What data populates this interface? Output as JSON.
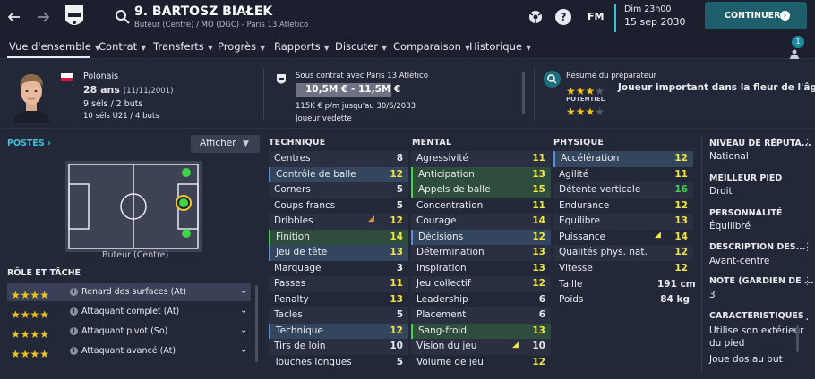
{
  "header": {
    "player_title": "9. BARTOSZ BIAŁEK",
    "player_subtitle": "Buteur (Centre) / MO (DGC) - Paris 13 Atlético",
    "fm_label": "FM",
    "date_time": "Dim 23h00",
    "date": "15 sep 2030",
    "continue_label": "CONTINUER",
    "notification_count": "1"
  },
  "nav": {
    "items": [
      "Vue d'ensemble",
      "Contrat",
      "Transferts",
      "Progrès",
      "Rapports",
      "Discuter",
      "Comparaison",
      "Historique"
    ]
  },
  "info": {
    "nationality": "Polonais",
    "age": "28 ans",
    "birthdate": "(11/11/2001)",
    "caps": "9 séls / 2 buts",
    "u21": "10 séls U21 / 4 buts",
    "contract_title": "Sous contrat avec Paris 13 Atlético",
    "value": "10,5M € - 11,5M €",
    "wage": "115K € p/m jusqu'au 30/6/2033",
    "status": "Joueur vedette",
    "coach_title": "Résumé du préparateur",
    "coach_summary": "Joueur important dans la fleur de l'âge",
    "potential_label": "POTENTIEL",
    "current_stars": 3,
    "potential_stars": 3
  },
  "positions": {
    "title": "POSTES",
    "show_button": "Afficher",
    "position_label": "Buteur (Centre)"
  },
  "roles": {
    "title": "RÔLE ET TÂCHE",
    "items": [
      {
        "name": "Renard des surfaces (At)",
        "stars": 4
      },
      {
        "name": "Attaquant complet (At)",
        "stars": 4
      },
      {
        "name": "Attaquant pivot (So)",
        "stars": 4
      },
      {
        "name": "Attaquant avancé (At)",
        "stars": 4
      }
    ]
  },
  "attributes": {
    "technique_title": "TECHNIQUE",
    "mental_title": "MENTAL",
    "physique_title": "PHYSIQUE",
    "technique": [
      {
        "name": "Centres",
        "value": "8"
      },
      {
        "name": "Contrôle de balle",
        "value": "12"
      },
      {
        "name": "Corners",
        "value": "5"
      },
      {
        "name": "Coups francs",
        "value": "5"
      },
      {
        "name": "Dribbles",
        "value": "12"
      },
      {
        "name": "Finition",
        "value": "14"
      },
      {
        "name": "Jeu de tête",
        "value": "13"
      },
      {
        "name": "Marquage",
        "value": "3"
      },
      {
        "name": "Passes",
        "value": "11"
      },
      {
        "name": "Penalty",
        "value": "13"
      },
      {
        "name": "Tacles",
        "value": "5"
      },
      {
        "name": "Technique",
        "value": "12"
      },
      {
        "name": "Tirs de loin",
        "value": "10"
      },
      {
        "name": "Touches longues",
        "value": "5"
      }
    ],
    "mental": [
      {
        "name": "Agressivité",
        "value": "11"
      },
      {
        "name": "Anticipation",
        "value": "13"
      },
      {
        "name": "Appels de balle",
        "value": "15"
      },
      {
        "name": "Concentration",
        "value": "11"
      },
      {
        "name": "Courage",
        "value": "14"
      },
      {
        "name": "Décisions",
        "value": "12"
      },
      {
        "name": "Détermination",
        "value": "13"
      },
      {
        "name": "Inspiration",
        "value": "13"
      },
      {
        "name": "Jeu collectif",
        "value": "12"
      },
      {
        "name": "Leadership",
        "value": "6"
      },
      {
        "name": "Placement",
        "value": "6"
      },
      {
        "name": "Sang-froid",
        "value": "13"
      },
      {
        "name": "Vision du jeu",
        "value": "10"
      },
      {
        "name": "Volume de jeu",
        "value": "12"
      }
    ],
    "physique": [
      {
        "name": "Accélération",
        "value": "12"
      },
      {
        "name": "Agilité",
        "value": "11"
      },
      {
        "name": "Détente verticale",
        "value": "16"
      },
      {
        "name": "Endurance",
        "value": "12"
      },
      {
        "name": "Équilibre",
        "value": "13"
      },
      {
        "name": "Puissance",
        "value": "14"
      },
      {
        "name": "Qualités phys. nat.",
        "value": "12"
      },
      {
        "name": "Vitesse",
        "value": "12"
      }
    ],
    "size_label": "Taille",
    "size_value": "191 cm",
    "weight_label": "Poids",
    "weight_value": "84 kg"
  },
  "right_panel": {
    "reputation_title": "NIVEAU DE RÉPUTA...",
    "reputation_value": "National",
    "foot_title": "MEILLEUR PIED",
    "foot_value": "Droit",
    "personality_title": "PERSONNALITÉ",
    "personality_value": "Équilibré",
    "description_title": "DESCRIPTION DES...",
    "description_value": "Avant-centre",
    "keeper_title": "NOTE (GARDIEN DE ...",
    "keeper_value": "3",
    "traits_title": "CARACTÉRISTIQUES JO",
    "trait_1a": "Utilise son extérieur",
    "trait_1b": "du pied",
    "trait_2": "Joue dos au but"
  },
  "colors": {
    "yellow": "#f2e83c",
    "green": "#3fd44a",
    "white": "#e8eaf0",
    "green_row": "#2f4d3c",
    "blue_row": "#33465e",
    "accent_teal": "#1e5f6b"
  }
}
